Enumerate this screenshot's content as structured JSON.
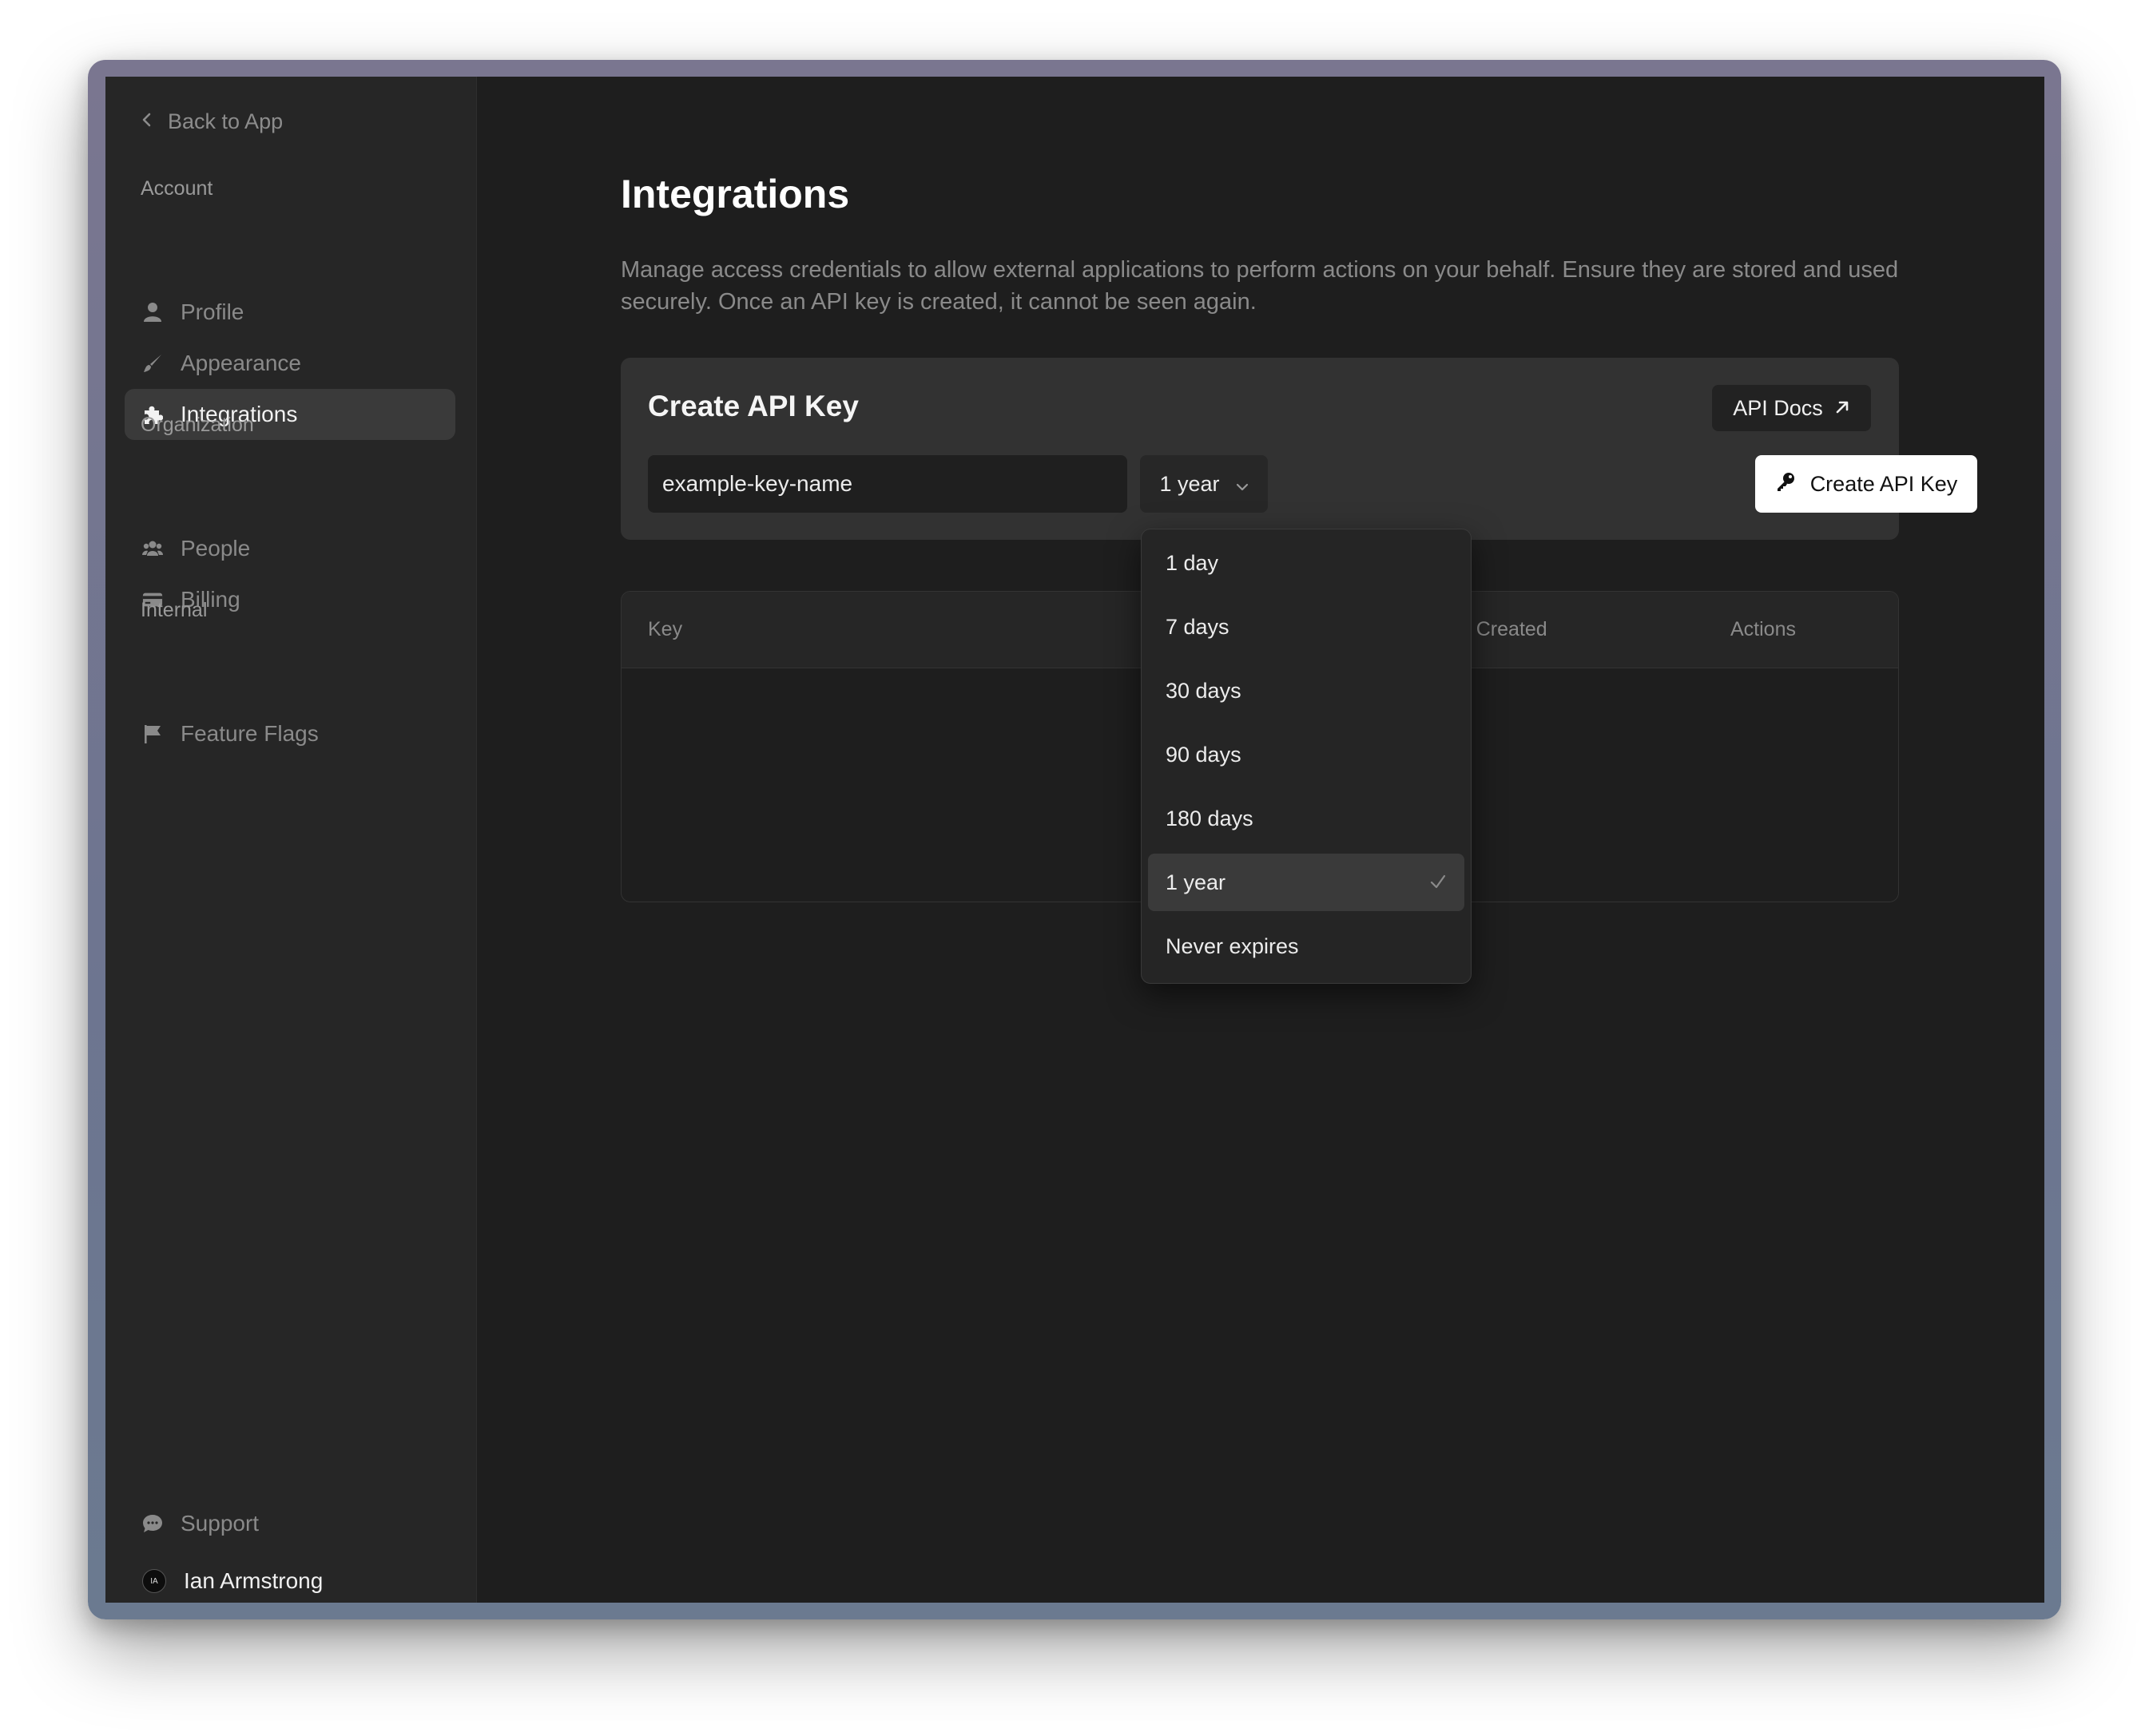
{
  "sidebar": {
    "back_label": "Back to App",
    "sections": [
      {
        "title": "Account",
        "items": [
          {
            "label": "Profile",
            "icon": "person-icon"
          },
          {
            "label": "Appearance",
            "icon": "brush-icon"
          },
          {
            "label": "Integrations",
            "icon": "puzzle-icon",
            "active": true
          }
        ]
      },
      {
        "title": "Organization",
        "items": [
          {
            "label": "People",
            "icon": "people-icon"
          },
          {
            "label": "Billing",
            "icon": "credit-card-icon"
          }
        ]
      },
      {
        "title": "Internal",
        "items": [
          {
            "label": "Feature Flags",
            "icon": "flag-icon"
          }
        ]
      }
    ],
    "support_label": "Support",
    "user": {
      "name": "Ian Armstrong",
      "initials": "IA"
    }
  },
  "main": {
    "title": "Integrations",
    "description": "Manage access credentials to allow external applications to perform actions on your behalf. Ensure they are stored and used securely. Once an API key is created, it cannot be seen again.",
    "create_card": {
      "title": "Create API Key",
      "docs_label": "API Docs",
      "key_name_value": "example-key-name",
      "expiry_selected": "1 year",
      "create_label": "Create API Key"
    },
    "table": {
      "columns": [
        "Key",
        "Date Created",
        "Actions"
      ]
    },
    "dropdown": {
      "options": [
        "1 day",
        "7 days",
        "30 days",
        "90 days",
        "180 days",
        "1 year",
        "Never expires"
      ],
      "selected": "1 year"
    }
  },
  "colors": {
    "background": "#1e1e1e",
    "sidebar": "#262626",
    "card": "#323232",
    "accent_button": "#ffffff"
  }
}
